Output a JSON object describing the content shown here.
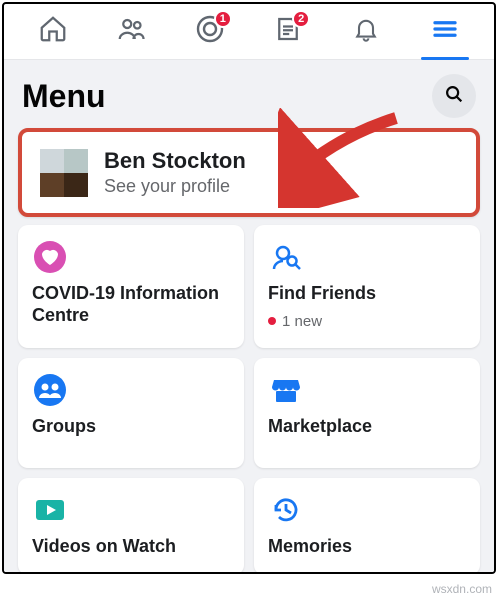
{
  "nav": {
    "badges": {
      "watch": "1",
      "news": "2"
    }
  },
  "menu": {
    "title": "Menu"
  },
  "profile": {
    "name": "Ben Stockton",
    "sub": "See your profile"
  },
  "tiles": {
    "covid": {
      "label": "COVID-19 Information Centre"
    },
    "findfriends": {
      "label": "Find Friends",
      "sub": "1 new"
    },
    "groups": {
      "label": "Groups"
    },
    "marketplace": {
      "label": "Marketplace"
    },
    "videos": {
      "label": "Videos on Watch"
    },
    "memories": {
      "label": "Memories"
    }
  },
  "watermark": "wsxdn.com"
}
